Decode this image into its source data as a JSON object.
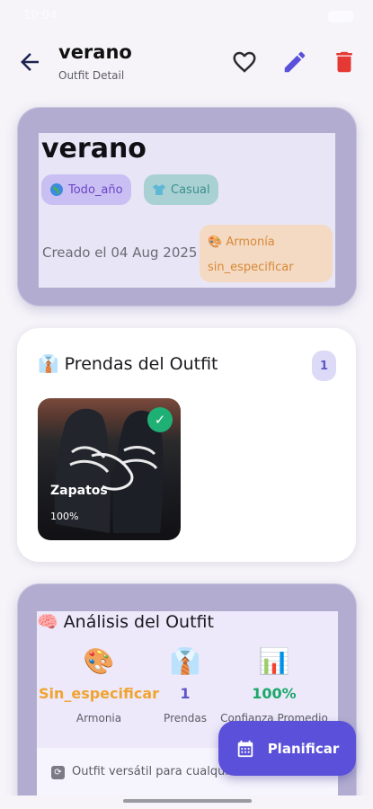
{
  "status_bar": {
    "time": "10:04"
  },
  "header": {
    "title": "verano",
    "subtitle": "Outfit Detail"
  },
  "summary": {
    "title": "verano",
    "season_chip": "Todo_año",
    "style_chip": "Casual",
    "created": "Creado el 04 Aug 2025",
    "harmony_label": "Armonía",
    "harmony_value": "sin_especificar"
  },
  "prendas": {
    "title": "Prendas del Outfit",
    "count": "1",
    "items": [
      {
        "name": "Zapatos",
        "percent": "100%"
      }
    ]
  },
  "analysis": {
    "title": "Análisis del Outfit",
    "stats": [
      {
        "value": "Sin_especificar",
        "label": "Armonia"
      },
      {
        "value": "1",
        "label": "Prendas"
      },
      {
        "value": "100%",
        "label": "Confianza Promedio"
      }
    ],
    "note": "Outfit versátil para cualquier ocasión"
  },
  "fab": {
    "label": "Planificar"
  },
  "colors": {
    "accent": "#5a50d9",
    "delete": "#e53935",
    "success": "#1fb075",
    "harmony": "#f0a330"
  },
  "icons": {
    "back": "arrow-back-icon",
    "favorite": "heart-outline-icon",
    "edit": "pencil-icon",
    "delete": "trash-icon",
    "calendar": "calendar-icon"
  }
}
